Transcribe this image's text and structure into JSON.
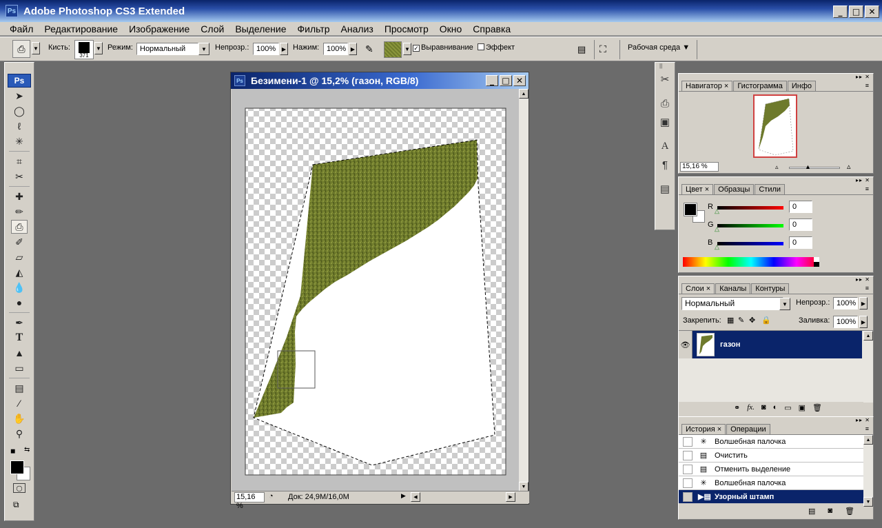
{
  "app": {
    "title": "Adobe Photoshop CS3 Extended",
    "logo": "Ps"
  },
  "menu": [
    "Файл",
    "Редактирование",
    "Изображение",
    "Слой",
    "Выделение",
    "Фильтр",
    "Анализ",
    "Просмотр",
    "Окно",
    "Справка"
  ],
  "options": {
    "brush_label": "Кисть:",
    "brush_size": "371",
    "mode_label": "Режим:",
    "mode_value": "Нормальный",
    "opacity_label": "Непрозр.:",
    "opacity_value": "100%",
    "flow_label": "Нажим:",
    "flow_value": "100%",
    "aligned_label": "Выравнивание",
    "aligned_checked": "✓",
    "impress_label": "Эффект",
    "workspace_label": "Рабочая среда"
  },
  "toolbox": {
    "logo": "Ps"
  },
  "document": {
    "icon": "Ps",
    "title": "Безимени-1 @ 15,2% (газон, RGB/8)",
    "zoom": "15,16 %",
    "doc_info": "Док: 24,9M/16,0M"
  },
  "navigator": {
    "tabs": [
      "Навигатор",
      "Гистограмма",
      "Инфо"
    ],
    "zoom": "15,16 %"
  },
  "color": {
    "tabs": [
      "Цвет",
      "Образцы",
      "Стили"
    ],
    "channels": [
      {
        "label": "R",
        "value": "0"
      },
      {
        "label": "G",
        "value": "0"
      },
      {
        "label": "B",
        "value": "0"
      }
    ]
  },
  "layers": {
    "tabs": [
      "Слои",
      "Каналы",
      "Контуры"
    ],
    "blend_mode": "Нормальный",
    "opacity_label": "Непрозр.:",
    "opacity_value": "100%",
    "lock_label": "Закрепить:",
    "fill_label": "Заливка:",
    "fill_value": "100%",
    "layer_name": "газон"
  },
  "history": {
    "tabs": [
      "История",
      "Операции"
    ],
    "items": [
      "Волшебная палочка",
      "Очистить",
      "Отменить выделение",
      "Волшебная палочка",
      "Узорный штамп"
    ]
  },
  "colors": {
    "grass": "#6e7a2c",
    "title_blue": "#0a246a",
    "chrome": "#d4d0c8"
  }
}
